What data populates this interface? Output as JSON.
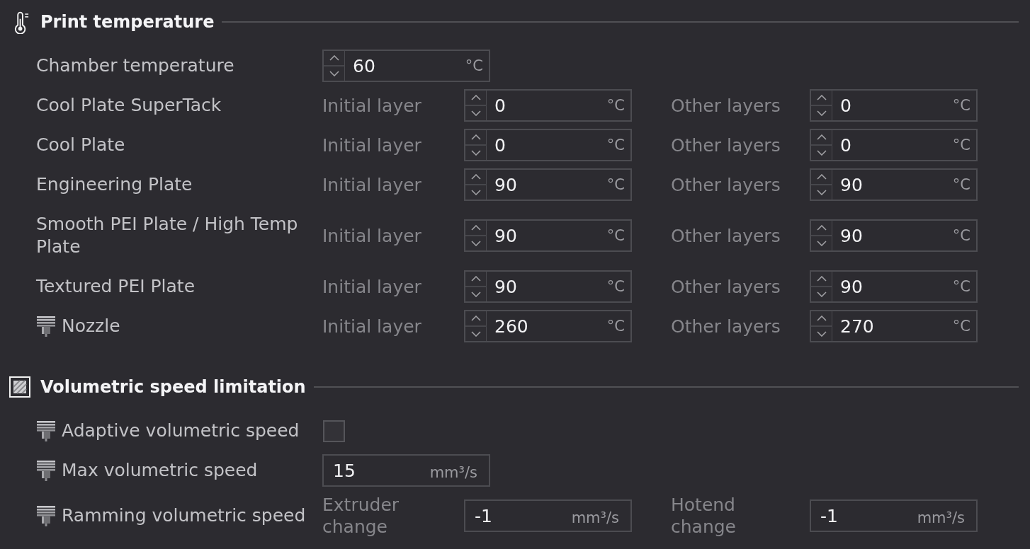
{
  "sections": [
    {
      "title": "Print temperature",
      "rows": [
        {
          "label": "Chamber temperature",
          "has_icon": false,
          "kind": "fields",
          "fields": [
            {
              "value": "60",
              "unit": "°C",
              "stepper": true
            }
          ]
        },
        {
          "label": "Cool Plate SuperTack",
          "has_icon": false,
          "kind": "fields",
          "fields": [
            {
              "label": "Initial layer",
              "value": "0",
              "unit": "°C",
              "stepper": true
            },
            {
              "label": "Other layers",
              "value": "0",
              "unit": "°C",
              "stepper": true
            }
          ]
        },
        {
          "label": "Cool Plate",
          "has_icon": false,
          "kind": "fields",
          "fields": [
            {
              "label": "Initial layer",
              "value": "0",
              "unit": "°C",
              "stepper": true
            },
            {
              "label": "Other layers",
              "value": "0",
              "unit": "°C",
              "stepper": true
            }
          ]
        },
        {
          "label": "Engineering Plate",
          "has_icon": false,
          "kind": "fields",
          "fields": [
            {
              "label": "Initial layer",
              "value": "90",
              "unit": "°C",
              "stepper": true
            },
            {
              "label": "Other layers",
              "value": "90",
              "unit": "°C",
              "stepper": true
            }
          ]
        },
        {
          "label": "Smooth PEI Plate / High Temp Plate",
          "has_icon": false,
          "kind": "fields",
          "fields": [
            {
              "label": "Initial layer",
              "value": "90",
              "unit": "°C",
              "stepper": true
            },
            {
              "label": "Other layers",
              "value": "90",
              "unit": "°C",
              "stepper": true
            }
          ]
        },
        {
          "label": "Textured PEI Plate",
          "has_icon": false,
          "kind": "fields",
          "fields": [
            {
              "label": "Initial layer",
              "value": "90",
              "unit": "°C",
              "stepper": true
            },
            {
              "label": "Other layers",
              "value": "90",
              "unit": "°C",
              "stepper": true
            }
          ]
        },
        {
          "label": "Nozzle",
          "has_icon": true,
          "kind": "fields",
          "fields": [
            {
              "label": "Initial layer",
              "value": "260",
              "unit": "°C",
              "stepper": true
            },
            {
              "label": "Other layers",
              "value": "270",
              "unit": "°C",
              "stepper": true
            }
          ]
        }
      ]
    },
    {
      "title": "Volumetric speed limitation",
      "rows": [
        {
          "label": "Adaptive volumetric speed",
          "has_icon": true,
          "kind": "checkbox",
          "checked": false
        },
        {
          "label": "Max volumetric speed",
          "has_icon": true,
          "kind": "fields",
          "fields": [
            {
              "value": "15",
              "unit": "mm³/s",
              "stepper": false
            }
          ]
        },
        {
          "label": "Ramming volumetric speed",
          "has_icon": true,
          "kind": "fields",
          "fields": [
            {
              "label": "Extruder change",
              "value": "-1",
              "unit": "mm³/s",
              "stepper": false
            },
            {
              "label": "Hotend change",
              "value": "-1",
              "unit": "mm³/s",
              "stepper": false
            }
          ]
        }
      ]
    }
  ]
}
